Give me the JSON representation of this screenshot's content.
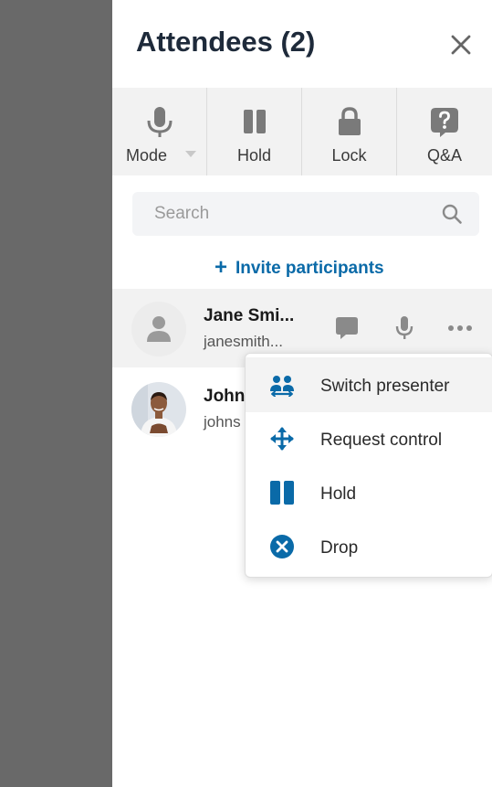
{
  "header": {
    "title": "Attendees (2)"
  },
  "toolbar": {
    "items": [
      {
        "label": "Mode",
        "icon": "microphone-icon"
      },
      {
        "label": "Hold",
        "icon": "pause-icon"
      },
      {
        "label": "Lock",
        "icon": "lock-icon"
      },
      {
        "label": "Q&A",
        "icon": "question-bubble-icon"
      }
    ]
  },
  "search": {
    "placeholder": "Search"
  },
  "invite": {
    "label": "Invite participants"
  },
  "participants": [
    {
      "name": "Jane Smi...",
      "email": "janesmith..."
    },
    {
      "name": "John",
      "email": "johns"
    }
  ],
  "context_menu": {
    "items": [
      {
        "label": "Switch presenter",
        "icon": "switch-presenter-icon"
      },
      {
        "label": "Request control",
        "icon": "move-arrows-icon"
      },
      {
        "label": "Hold",
        "icon": "pause-icon"
      },
      {
        "label": "Drop",
        "icon": "drop-x-circle-icon"
      }
    ]
  },
  "colors": {
    "accent": "#0a6aa8",
    "title": "#1e2a3a",
    "toolbar_bg": "#f2f2f2",
    "backdrop": "#696969"
  }
}
